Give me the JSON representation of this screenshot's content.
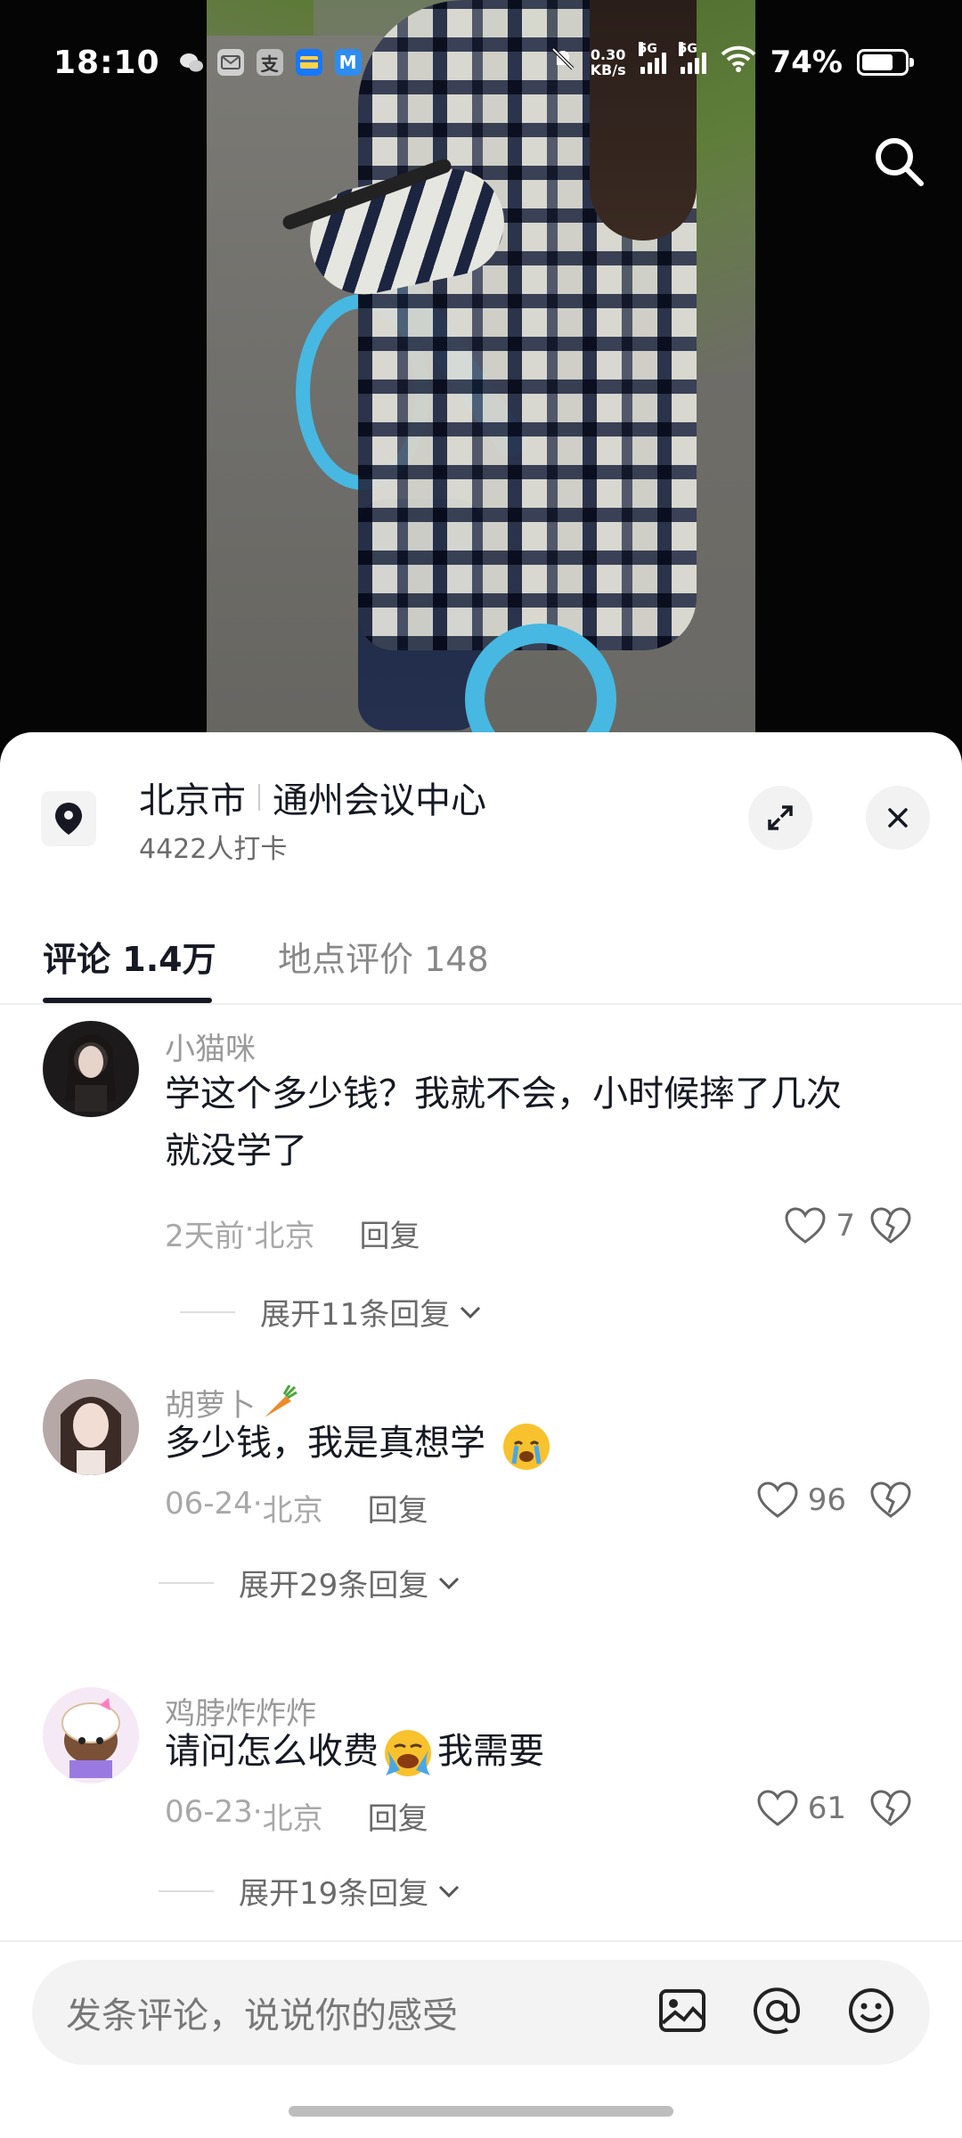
{
  "status_bar": {
    "time": "18:10",
    "net_speed_value": "0.30",
    "net_speed_unit": "KB/s",
    "signal1_tag": "5G",
    "signal2_tag": "5G",
    "battery": "74%",
    "app_icons": [
      "wechat-icon",
      "mail-icon",
      "alipay-icon",
      "wallet-icon",
      "app-m-icon"
    ],
    "app_icon_glyphs": [
      "",
      "",
      "支",
      "",
      "M"
    ]
  },
  "location": {
    "city": "北京市",
    "place": "通州会议中心",
    "checkins": "4422人打卡"
  },
  "tabs": [
    {
      "label": "评论",
      "count": "1.4万"
    },
    {
      "label": "地点评价",
      "count": "148"
    }
  ],
  "comments": [
    {
      "user": "小猫咪",
      "text_lines": [
        "学这个多少钱？我就不会，小时候摔了几次",
        "就没学了"
      ],
      "date": "2天前",
      "region": "北京",
      "reply_label": "回复",
      "likes": "7",
      "expand_label": "展开11条回复"
    },
    {
      "user": "胡萝卜",
      "text": "多少钱，我是真想学",
      "date": "06-24",
      "region": "北京",
      "reply_label": "回复",
      "likes": "96",
      "expand_label": "展开29条回复"
    },
    {
      "user": "鸡脖炸炸炸",
      "text_before": "请问怎么收费",
      "text_after": "我需要",
      "date": "06-23",
      "region": "北京",
      "reply_label": "回复",
      "likes": "61",
      "expand_label": "展开19条回复"
    }
  ],
  "input": {
    "placeholder": "发条评论，说说你的感受",
    "icons": [
      "image-icon",
      "at-icon",
      "emoji-icon"
    ]
  },
  "meta_separator": " · "
}
